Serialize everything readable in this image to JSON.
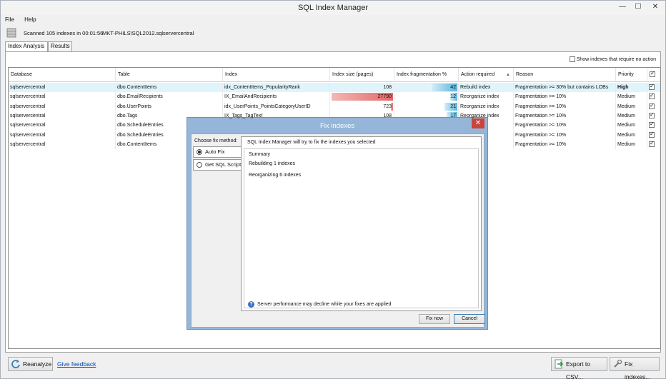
{
  "window": {
    "title": "SQL Index Manager",
    "min_glyph": "—",
    "max_glyph": "☐",
    "close_glyph": "✕"
  },
  "menu": {
    "file": "File",
    "help": "Help"
  },
  "scan": {
    "text": "Scanned 105 indexes in 00:01:56",
    "server": "MKT-PHILS\\SQL2012.sqlservercentral"
  },
  "tabs": {
    "index_analysis": "Index Analysis",
    "results": "Results"
  },
  "filter": {
    "show_no_action_label": "Show indexes that require no action",
    "show_no_action_checked": false
  },
  "grid": {
    "headers": {
      "database": "Database",
      "table": "Table",
      "index": "Index",
      "index_size": "Index size (pages)",
      "index_frag": "Index fragmentation %",
      "action": "Action required",
      "sort_glyph": "▲",
      "reason": "Reason",
      "priority": "Priority"
    },
    "rows": [
      {
        "database": "sqlservercentral",
        "table": "dbo.ContentItems",
        "index": "idx_ContentItems_PopularityRank",
        "size": "108",
        "size_fill": 0.0,
        "frag": "42",
        "frag_fill": 0.42,
        "action": "Rebuild index",
        "reason": "Fragmentation >= 30% but contains LOBs",
        "priority": "High",
        "checked": true
      },
      {
        "database": "sqlservercentral",
        "table": "dbo.EmailRecipients",
        "index": "IX_EmailAndRecipients",
        "size": "27790",
        "size_fill": 1.0,
        "frag": "12",
        "frag_fill": 0.12,
        "action": "Reorganize index",
        "reason": "Fragmentation >= 10%",
        "priority": "Medium",
        "checked": true
      },
      {
        "database": "sqlservercentral",
        "table": "dbo.UserPoints",
        "index": "idx_UserPoints_PointsCategoryUserID",
        "size": "723",
        "size_fill": 0.03,
        "frag": "21",
        "frag_fill": 0.21,
        "action": "Reorganize index",
        "reason": "Fragmentation >= 10%",
        "priority": "Medium",
        "checked": true
      },
      {
        "database": "sqlservercentral",
        "table": "dbo.Tags",
        "index": "IX_Tags_TagText",
        "size": "108",
        "size_fill": 0.0,
        "frag": "17",
        "frag_fill": 0.17,
        "action": "Reorganize index",
        "reason": "Fragmentation >= 10%",
        "priority": "Medium",
        "checked": true
      },
      {
        "database": "sqlservercentral",
        "table": "dbo.ScheduleEntries",
        "index": "",
        "size": "",
        "size_fill": 0.0,
        "frag": "",
        "frag_fill": 0.0,
        "action": "",
        "reason": "Fragmentation >= 10%",
        "priority": "Medium",
        "checked": true
      },
      {
        "database": "sqlservercentral",
        "table": "dbo.ScheduleEntries",
        "index": "",
        "size": "",
        "size_fill": 0.0,
        "frag": "",
        "frag_fill": 0.0,
        "action": "",
        "reason": "Fragmentation >= 10%",
        "priority": "Medium",
        "checked": true
      },
      {
        "database": "sqlservercentral",
        "table": "dbo.ContentItems",
        "index": "",
        "size": "",
        "size_fill": 0.0,
        "frag": "",
        "frag_fill": 0.0,
        "action": "",
        "reason": "Fragmentation >= 10%",
        "priority": "Medium",
        "checked": true
      }
    ]
  },
  "dialog": {
    "title": "Fix indexes",
    "close_glyph": "✕",
    "method_label": "Choose fix method:",
    "auto_fix": "Auto Fix",
    "get_sql_script": "Get SQL Script",
    "intro": "SQL Index Manager will try to fix the indexes you selected",
    "summary_title": "Summary",
    "rebuilding": "Rebuilding 1 indexes",
    "reorganizing": "Reorganizing 6 indexes",
    "info_glyph": "?",
    "warning": "Server performance may decline while your fixes are applied",
    "fix_now": "Fix now",
    "cancel": "Cancel"
  },
  "bottom": {
    "reanalyze": "Reanalyze",
    "feedback": "Give feedback",
    "export": "Export to CSV...",
    "fix_indexes": "Fix indexes..."
  },
  "colors": {
    "selected_row": "#dff4fb",
    "size_bar": "#e2686a",
    "frag_bar": "#5ab4dc",
    "dialog_frame": "#95b6d9",
    "link": "#0645ad"
  }
}
